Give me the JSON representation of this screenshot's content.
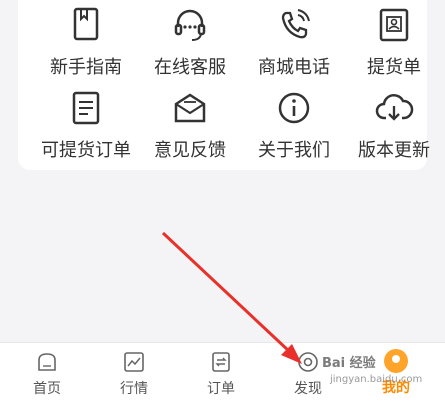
{
  "grid": {
    "items": [
      {
        "label": "新手指南",
        "icon": "guide-book-icon"
      },
      {
        "label": "在线客服",
        "icon": "headset-icon"
      },
      {
        "label": "商城电话",
        "icon": "phone-icon"
      },
      {
        "label": "提货单",
        "icon": "pickup-slip-icon"
      },
      {
        "label": "可提货订单",
        "icon": "order-list-icon"
      },
      {
        "label": "意见反馈",
        "icon": "feedback-mail-icon"
      },
      {
        "label": "关于我们",
        "icon": "info-icon"
      },
      {
        "label": "版本更新",
        "icon": "cloud-download-icon"
      }
    ]
  },
  "tabbar": {
    "tabs": [
      {
        "label": "首页",
        "icon": "home-icon"
      },
      {
        "label": "行情",
        "icon": "chart-icon"
      },
      {
        "label": "订单",
        "icon": "order-icon"
      },
      {
        "label": "发现",
        "icon": "discover-icon"
      },
      {
        "label": "我的",
        "icon": "profile-icon",
        "active": true
      }
    ]
  },
  "watermark": {
    "line1": "Bai 经验",
    "line2": "jingyan.baidu.com"
  },
  "colors": {
    "accent": "#ff8a00",
    "arrow": "#e8312a",
    "icon_stroke": "#333333"
  }
}
